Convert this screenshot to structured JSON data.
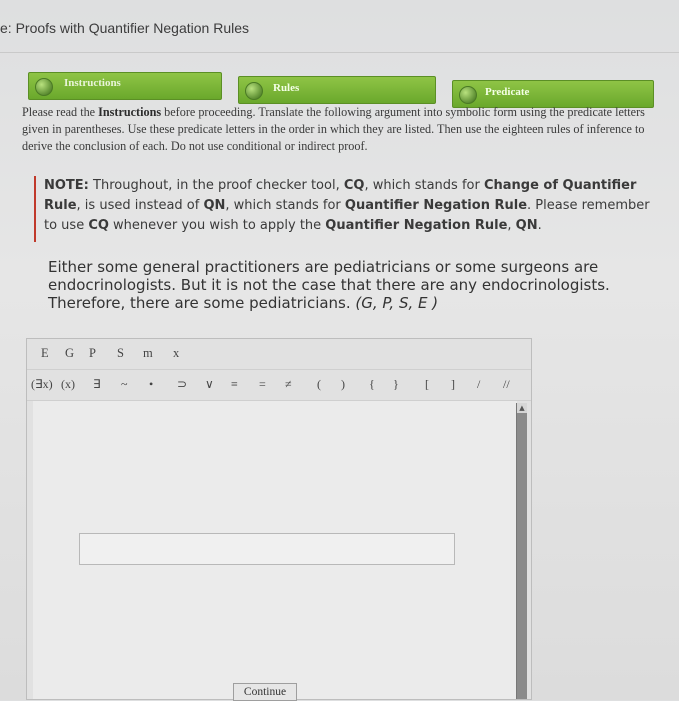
{
  "window": {
    "title": "e: Proofs with Quantifier Negation Rules"
  },
  "tabs": [
    {
      "label": "Instructions"
    },
    {
      "label": "Rules"
    },
    {
      "label": "Predicate"
    }
  ],
  "instructions": {
    "p1": "Please read the ",
    "bold1": "Instructions",
    "p2": " before proceeding. Translate the following argument into symbolic form using the predicate letters given in parentheses. Use these predicate letters in the order in which they are listed. Then use the eighteen rules of inference to derive the conclusion of each. Do not use conditional or indirect proof."
  },
  "note": {
    "label": "NOTE:",
    "t1": " Throughout, in the proof checker tool, ",
    "cq": "CQ",
    "t2": ", which stands for ",
    "cq_full": "Change of Quantifier Rule",
    "t3": ", is used instead of ",
    "qn": "QN",
    "t4": ", which stands for ",
    "qn_full": "Quantifier Negation Rule",
    "t5": ". Please remember to use ",
    "cq2": "CQ",
    "t6": " whenever you wish to apply the ",
    "qn_full2": "Quantifier Negation Rule",
    "t7": ", ",
    "qn2": "QN",
    "t8": "."
  },
  "argument": {
    "text": "Either some general practitioners are pediatricians or some surgeons are endocrinologists. But it is not the case that there are any endocrinologists. Therefore, there are some pediatricians. ",
    "letters": "(G, P, S, E )"
  },
  "checker": {
    "letters": [
      "E",
      "G",
      "P",
      "S",
      "m",
      "x"
    ],
    "symbols": [
      "(∃x)",
      "(x)",
      "∃",
      "~",
      "•",
      "⊃",
      "∨",
      "≡",
      "=",
      "≠",
      "(",
      ")",
      "{",
      "}",
      "[",
      "]",
      "/",
      "//"
    ],
    "input_value": "",
    "continue_label": "Continue"
  }
}
